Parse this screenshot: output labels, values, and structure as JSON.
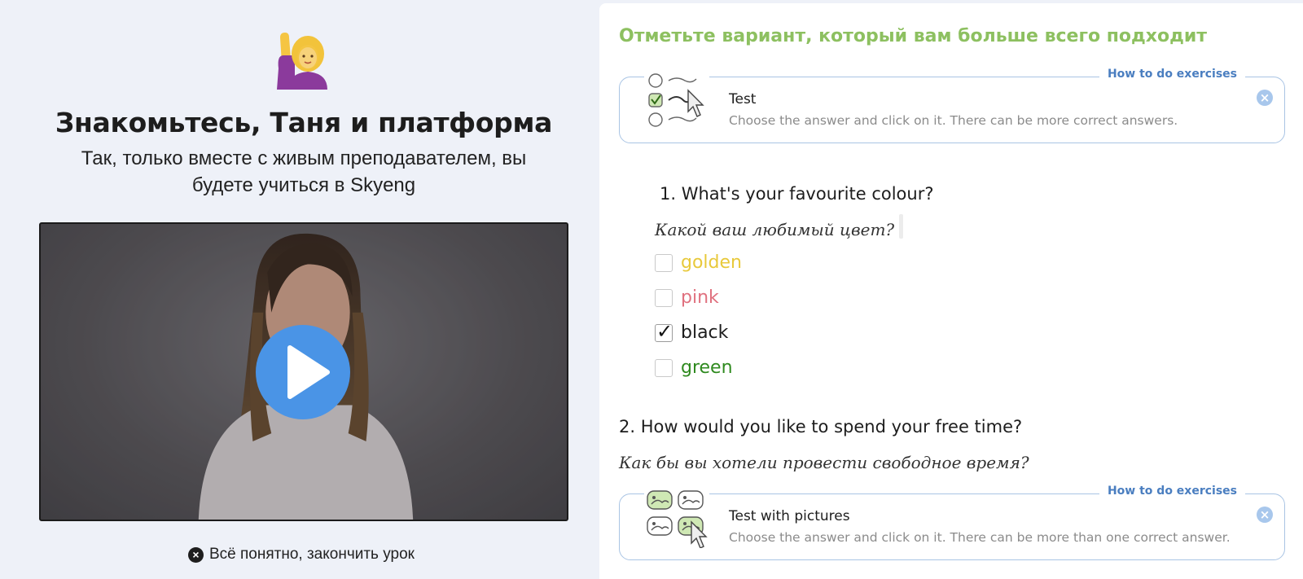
{
  "intro": {
    "title": "Знакомьтесь, Таня и платформа",
    "subtitle": "Так, только вместе с живым преподавателем, вы будете учиться в Skyeng",
    "finish_label": "Всё понятно, закончить урок",
    "emoji": "person-raising-hand-icon"
  },
  "video": {
    "play_icon": "play-icon",
    "accent": "#4a94e6"
  },
  "exercise": {
    "heading": "Отметьте вариант, который вам больше всего подходит",
    "heading_color": "#8dc060",
    "boxes": [
      {
        "howto": "How to do exercises",
        "title": "Test",
        "desc": "Choose the answer and click on it. There can be more correct answers.",
        "icon": "test-checklist-icon"
      },
      {
        "howto": "How to do exercises",
        "title": "Test with pictures",
        "desc": "Choose the answer and click on it. There can be more than one correct answer.",
        "icon": "test-pictures-icon"
      }
    ],
    "questions": [
      {
        "title": "1. What's your favourite colour?",
        "translation": "Какой ваш любимый цвет?",
        "options": [
          {
            "label": "golden",
            "color": "#e8c93b",
            "checked": false
          },
          {
            "label": "pink",
            "color": "#e0717f",
            "checked": false
          },
          {
            "label": "black",
            "color": "#1d1d1d",
            "checked": true
          },
          {
            "label": "green",
            "color": "#2f8a1f",
            "checked": false
          }
        ]
      },
      {
        "title": "2. How would you like to spend your free time?",
        "translation": "Как бы вы хотели провести свободное время?"
      }
    ]
  }
}
